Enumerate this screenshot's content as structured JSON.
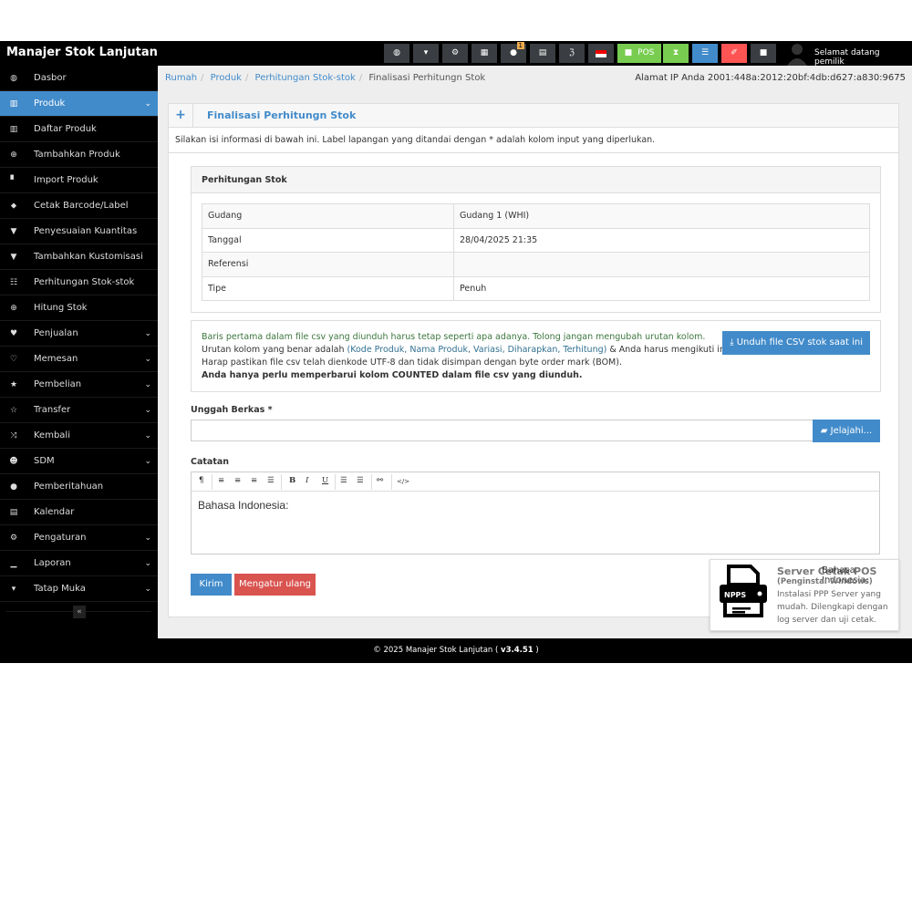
{
  "app": {
    "title": "Manajer Stok Lanjutan",
    "welcome": "Selamat datang pemilik"
  },
  "navbar": {
    "buttons": [
      {
        "icon": "dashboard-icon",
        "glyph": "◍"
      },
      {
        "icon": "cart-icon",
        "glyph": "▾"
      },
      {
        "icon": "cogs-icon",
        "glyph": "⚙"
      },
      {
        "icon": "calculator-icon",
        "glyph": "▦"
      },
      {
        "icon": "info-icon",
        "glyph": "●",
        "badge": "1"
      },
      {
        "icon": "calendar-icon",
        "glyph": "▤"
      },
      {
        "icon": "html5-icon",
        "glyph": "ℨ"
      },
      {
        "icon": "flag-icon",
        "glyph": ""
      },
      {
        "icon": "pos-icon",
        "glyph": "■",
        "label": "POS"
      },
      {
        "icon": "hourglass-icon",
        "glyph": "⧗"
      },
      {
        "icon": "list-icon",
        "glyph": "☰"
      },
      {
        "icon": "eraser-icon",
        "glyph": "✐"
      },
      {
        "icon": "grid-icon",
        "glyph": "■"
      }
    ],
    "colors": {
      "dark": "#3a3d41",
      "green": "#78cd51",
      "blue": "#428bca",
      "red": "#ff5454"
    }
  },
  "sidebar": {
    "items": [
      {
        "label": "Dasbor",
        "icon": "◍"
      },
      {
        "label": "Produk",
        "icon": "▥",
        "chevron": "⌄",
        "active": true
      },
      {
        "label": "Daftar Produk",
        "icon": "▥"
      },
      {
        "label": "Tambahkan Produk",
        "icon": "⊕"
      },
      {
        "label": "Import Produk",
        "icon": "▘"
      },
      {
        "label": "Cetak Barcode/Label",
        "icon": "⬥"
      },
      {
        "label": "Penyesuaian Kuantitas",
        "icon": "▼"
      },
      {
        "label": "Tambahkan Kustomisasi",
        "icon": "▼"
      },
      {
        "label": "Perhitungan Stok-stok",
        "icon": "☷"
      },
      {
        "label": "Hitung Stok",
        "icon": "⊕"
      },
      {
        "label": "Penjualan",
        "icon": "♥",
        "chevron": "⌄"
      },
      {
        "label": "Memesan",
        "icon": "♡",
        "chevron": "⌄"
      },
      {
        "label": "Pembelian",
        "icon": "★",
        "chevron": "⌄"
      },
      {
        "label": "Transfer",
        "icon": "☆",
        "chevron": "⌄"
      },
      {
        "label": "Kembali",
        "icon": "⤨",
        "chevron": "⌄"
      },
      {
        "label": "SDM",
        "icon": "☻",
        "chevron": "⌄"
      },
      {
        "label": "Pemberitahuan",
        "icon": "●"
      },
      {
        "label": "Kalendar",
        "icon": "▤"
      },
      {
        "label": "Pengaturan",
        "icon": "⚙",
        "chevron": "⌄"
      },
      {
        "label": "Laporan",
        "icon": "▁",
        "chevron": "⌄"
      },
      {
        "label": "Tatap Muka",
        "icon": "▾",
        "chevron": "⌄"
      }
    ],
    "collapse": "«"
  },
  "breadcrumb": [
    "Rumah",
    "Produk",
    "Perhitungan Stok-stok",
    "Finalisasi Perhitungn Stok"
  ],
  "ip": "Alamat IP Anda 2001:448a:2012:20bf:4db:d627:a830:9675",
  "panel": {
    "title": "Finalisasi Perhitungn Stok",
    "plus": "+",
    "description": "Silakan isi informasi di bawah ini. Label lapangan yang ditandai dengan * adalah kolom input yang diperlukan.",
    "table_title": "Perhitungan Stok",
    "rows": [
      [
        "Gudang",
        "Gudang 1 (WHI)"
      ],
      [
        "Tanggal",
        "28/04/2025 21:35"
      ],
      [
        "Referensi",
        ""
      ],
      [
        "Tipe",
        "Penuh"
      ]
    ],
    "info": {
      "line1": "Baris pertama dalam file csv yang diunduh harus tetap seperti apa adanya. Tolong jangan mengubah urutan kolom.",
      "line2a": "Urutan kolom yang benar adalah ",
      "line2b": "(Kode Produk, Nama Produk, Variasi, Diharapkan, Terhitung)",
      "line2c": " & Anda harus mengikuti ini.",
      "line3": "Harap pastikan file csv telah dienkode UTF-8 dan tidak disimpan dengan byte order mark (BOM).",
      "line4": "Anda hanya perlu memperbarui kolom COUNTED dalam file csv yang diunduh.",
      "download": "Unduh file CSV stok saat ini"
    },
    "upload_label": "Unggah Berkas *",
    "upload_value": "",
    "browse": "Jelajahi...",
    "notes_label": "Catatan",
    "notes_value": "Bahasa Indonesia:",
    "submit": "Kirim",
    "reset": "Mengatur ulang"
  },
  "popup": {
    "title": "Server Cetak POS",
    "overlay_text": "Bahasa Indonesia:",
    "subtitle": "(Penginstal Windows)",
    "body": "Instalasi PPP Server yang mudah. Dilengkapi dengan log server dan uji cetak.",
    "logo_text": "NPPS"
  },
  "footer": {
    "text": "© 2025 Manajer Stok Lanjutan ( ",
    "version": "v3.4.51",
    " end": " )"
  }
}
